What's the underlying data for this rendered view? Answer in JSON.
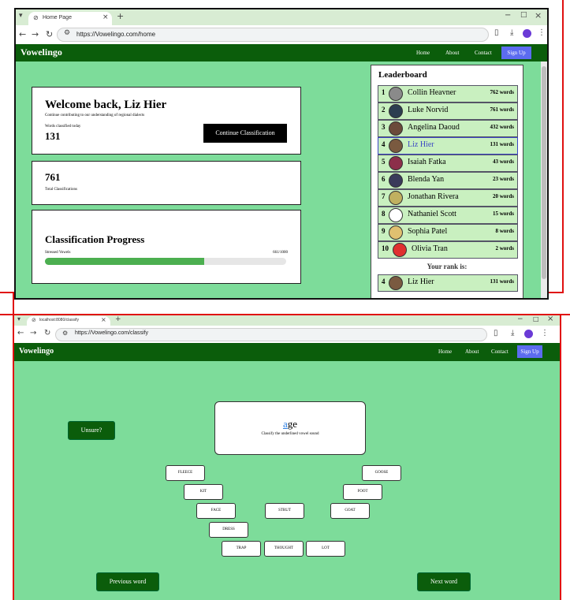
{
  "screen1": {
    "tab_title": "Home Page",
    "url": "https://Vowelingo.com/home",
    "brand": "Vowelingo",
    "nav": {
      "home": "Home",
      "about": "About",
      "contact": "Contact",
      "signup": "Sign Up"
    },
    "welcome": {
      "title": "Welcome back, Liz Hier",
      "subtitle": "Continue contributing to our understanding of regional dialects",
      "today_label": "Words classified today",
      "today_value": "131",
      "continue_button": "Continue Classification"
    },
    "total": {
      "value": "761",
      "label": "Total Classifications"
    },
    "progress": {
      "title": "Classification Progress",
      "category": "Stressed Vowels",
      "count": "661/1000",
      "fraction": 0.661
    },
    "leaderboard": {
      "title": "Leaderboard",
      "rows": [
        {
          "rank": "1",
          "name": "Collin Heavner",
          "count": "762 words",
          "avatar_color": "#8a8a8a"
        },
        {
          "rank": "2",
          "name": "Luke Norvid",
          "count": "761 words",
          "avatar_color": "#2c3e50"
        },
        {
          "rank": "3",
          "name": "Angelina Daoud",
          "count": "432 words",
          "avatar_color": "#6b4a3a"
        },
        {
          "rank": "4",
          "name": "Liz Hier",
          "count": "131 words",
          "avatar_color": "#7a5a40"
        },
        {
          "rank": "5",
          "name": "Isaiah Fatka",
          "count": "43 words",
          "avatar_color": "#8c2f4a"
        },
        {
          "rank": "6",
          "name": "Blenda Yan",
          "count": "23 words",
          "avatar_color": "#3a3a5a"
        },
        {
          "rank": "7",
          "name": "Jonathan Rivera",
          "count": "20 words",
          "avatar_color": "#c0b060"
        },
        {
          "rank": "8",
          "name": "Nathaniel Scott",
          "count": "15 words",
          "avatar_color": "#ffffff"
        },
        {
          "rank": "9",
          "name": "Sophia Patel",
          "count": "8 words",
          "avatar_color": "#e0c070"
        },
        {
          "rank": "10",
          "name": "Olivia Tran",
          "count": "2 words",
          "avatar_color": "#e03030"
        }
      ],
      "your_rank_label": "Your rank is:",
      "your_rank": {
        "rank": "4",
        "name": "Liz Hier",
        "count": "131 words",
        "avatar_color": "#7a5a40"
      }
    }
  },
  "screen2": {
    "tab_title": "localhost:8080/classify",
    "url": "https://Vowelingo.com/classify",
    "brand": "Vowelingo",
    "nav": {
      "home": "Home",
      "about": "About",
      "contact": "Contact",
      "signup": "Sign Up"
    },
    "unsure_button": "Unsure?",
    "word": {
      "highlight": "a",
      "rest": "ge",
      "instruction": "Classify the underlined vowel sound"
    },
    "vowels": {
      "fleece": "FLEECE",
      "kit": "KIT",
      "face": "FACE",
      "dress": "DRESS",
      "trap": "TRAP",
      "strut": "STRUT",
      "thought": "THOUGHT",
      "lot": "LOT",
      "goat": "GOAT",
      "foot": "FOOT",
      "goose": "GOOSE"
    },
    "prev_button": "Previous word",
    "next_button": "Next word"
  },
  "colors": {
    "nav_green": "#0b5d0b",
    "page_green": "#7ddc9a",
    "signup_blue": "#5c6cf0",
    "progress_fill": "#4caf50",
    "annotation_red": "#e01010",
    "highlight_letter": "#2a7de1"
  },
  "icons": [
    "back-arrow-icon",
    "forward-arrow-icon",
    "reload-icon",
    "site-info-icon",
    "download-icon",
    "profile-icon",
    "menu-dots-icon",
    "close-icon",
    "new-tab-icon",
    "minimize-icon",
    "maximize-icon"
  ]
}
